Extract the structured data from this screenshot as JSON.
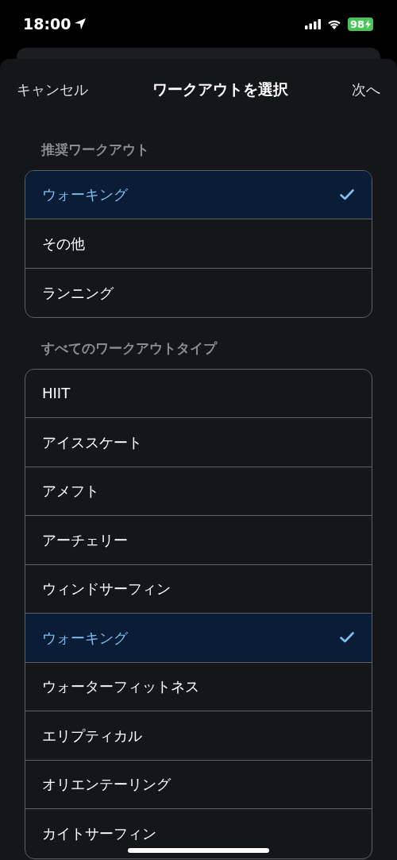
{
  "status_bar": {
    "time": "18:00",
    "battery": "98"
  },
  "nav": {
    "cancel": "キャンセル",
    "title": "ワークアウトを選択",
    "next": "次へ"
  },
  "sections": [
    {
      "header": "推奨ワークアウト",
      "items": [
        {
          "label": "ウォーキング",
          "selected": true
        },
        {
          "label": "その他",
          "selected": false
        },
        {
          "label": "ランニング",
          "selected": false
        }
      ]
    },
    {
      "header": "すべてのワークアウトタイプ",
      "items": [
        {
          "label": "HIIT",
          "selected": false
        },
        {
          "label": "アイススケート",
          "selected": false
        },
        {
          "label": "アメフト",
          "selected": false
        },
        {
          "label": "アーチェリー",
          "selected": false
        },
        {
          "label": "ウィンドサーフィン",
          "selected": false
        },
        {
          "label": "ウォーキング",
          "selected": true
        },
        {
          "label": "ウォーターフィットネス",
          "selected": false
        },
        {
          "label": "エリプティカル",
          "selected": false
        },
        {
          "label": "オリエンテーリング",
          "selected": false
        },
        {
          "label": "カイトサーフィン",
          "selected": false
        }
      ]
    }
  ]
}
